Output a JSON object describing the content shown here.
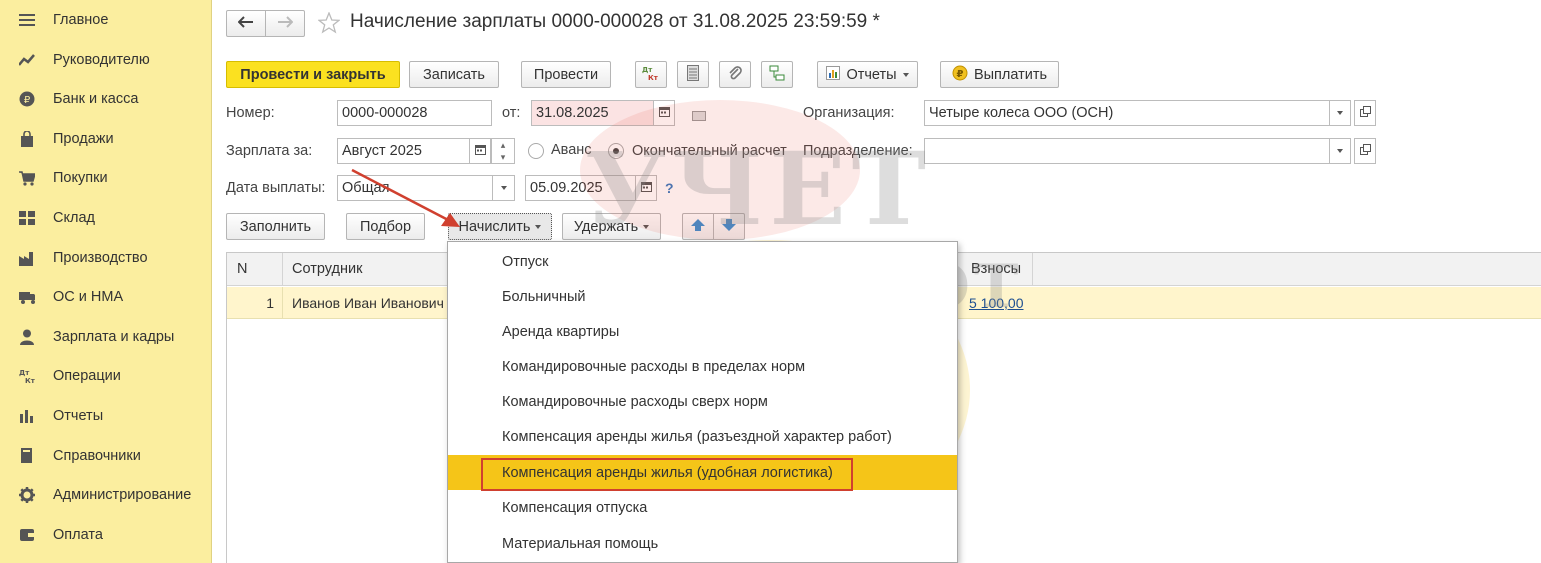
{
  "sidebar": {
    "items": [
      {
        "label": "Главное",
        "icon": "menu-icon"
      },
      {
        "label": "Руководителю",
        "icon": "trend-icon"
      },
      {
        "label": "Банк и касса",
        "icon": "ruble-coin-icon"
      },
      {
        "label": "Продажи",
        "icon": "shopping-bag-icon"
      },
      {
        "label": "Покупки",
        "icon": "cart-icon"
      },
      {
        "label": "Склад",
        "icon": "warehouse-icon"
      },
      {
        "label": "Производство",
        "icon": "factory-icon"
      },
      {
        "label": "ОС и НМА",
        "icon": "truck-icon"
      },
      {
        "label": "Зарплата и кадры",
        "icon": "person-icon"
      },
      {
        "label": "Операции",
        "icon": "dt-kt-icon"
      },
      {
        "label": "Отчеты",
        "icon": "bar-chart-icon"
      },
      {
        "label": "Справочники",
        "icon": "book-icon"
      },
      {
        "label": "Администрирование",
        "icon": "gear-icon"
      },
      {
        "label": "Оплата",
        "icon": "wallet-icon"
      }
    ]
  },
  "header": {
    "title": "Начисление зарплаты 0000-000028 от 31.08.2025 23:59:59 *"
  },
  "toolbar": {
    "post_close": "Провести и закрыть",
    "save": "Записать",
    "post": "Провести",
    "reports": "Отчеты",
    "pay": "Выплатить",
    "dtkt_icon_text": "Дт Кт"
  },
  "form": {
    "number_label": "Номер:",
    "number_value": "0000-000028",
    "from_label": "от:",
    "date_value": "31.08.2025",
    "org_label": "Организация:",
    "org_value": "Четыре колеса ООО (ОСН)",
    "salary_for_label": "Зарплата за:",
    "salary_for_value": "Август 2025",
    "advance_label": "Аванс",
    "final_label": "Окончательный расчет",
    "dept_label": "Подразделение:",
    "dept_value": "",
    "pay_date_label": "Дата выплаты:",
    "pay_date_type": "Общая",
    "pay_date_value": "05.09.2025",
    "help": "?"
  },
  "table_toolbar": {
    "fill": "Заполнить",
    "pick": "Подбор",
    "accrue": "Начислить",
    "deduct": "Удержать"
  },
  "table": {
    "columns": [
      "N",
      "Сотрудник",
      "Взносы"
    ],
    "rows": [
      {
        "n": "1",
        "employee": "Иванов Иван Иванович",
        "contributions": "5 100,00"
      }
    ]
  },
  "dropdown": {
    "items": [
      "Отпуск",
      "Больничный",
      "Аренда квартиры",
      "Командировочные расходы в пределах норм",
      "Командировочные расходы сверх норм",
      "Компенсация аренды жилья (разъездной характер работ)",
      "Компенсация аренды жилья (удобная логистика)",
      "Компенсация отпуска",
      "Материальная помощь"
    ],
    "highlighted_index": 6
  },
  "watermark": {
    "line1": "УЧЕТ",
    "line2": "БЕЗ ЗАБОТ"
  },
  "colors": {
    "sidebar_bg": "#fbee9f",
    "primary_button": "#fbe120",
    "highlight": "#f5c518",
    "annotation_red": "#d0402f",
    "row_bg": "#fff5cc"
  }
}
